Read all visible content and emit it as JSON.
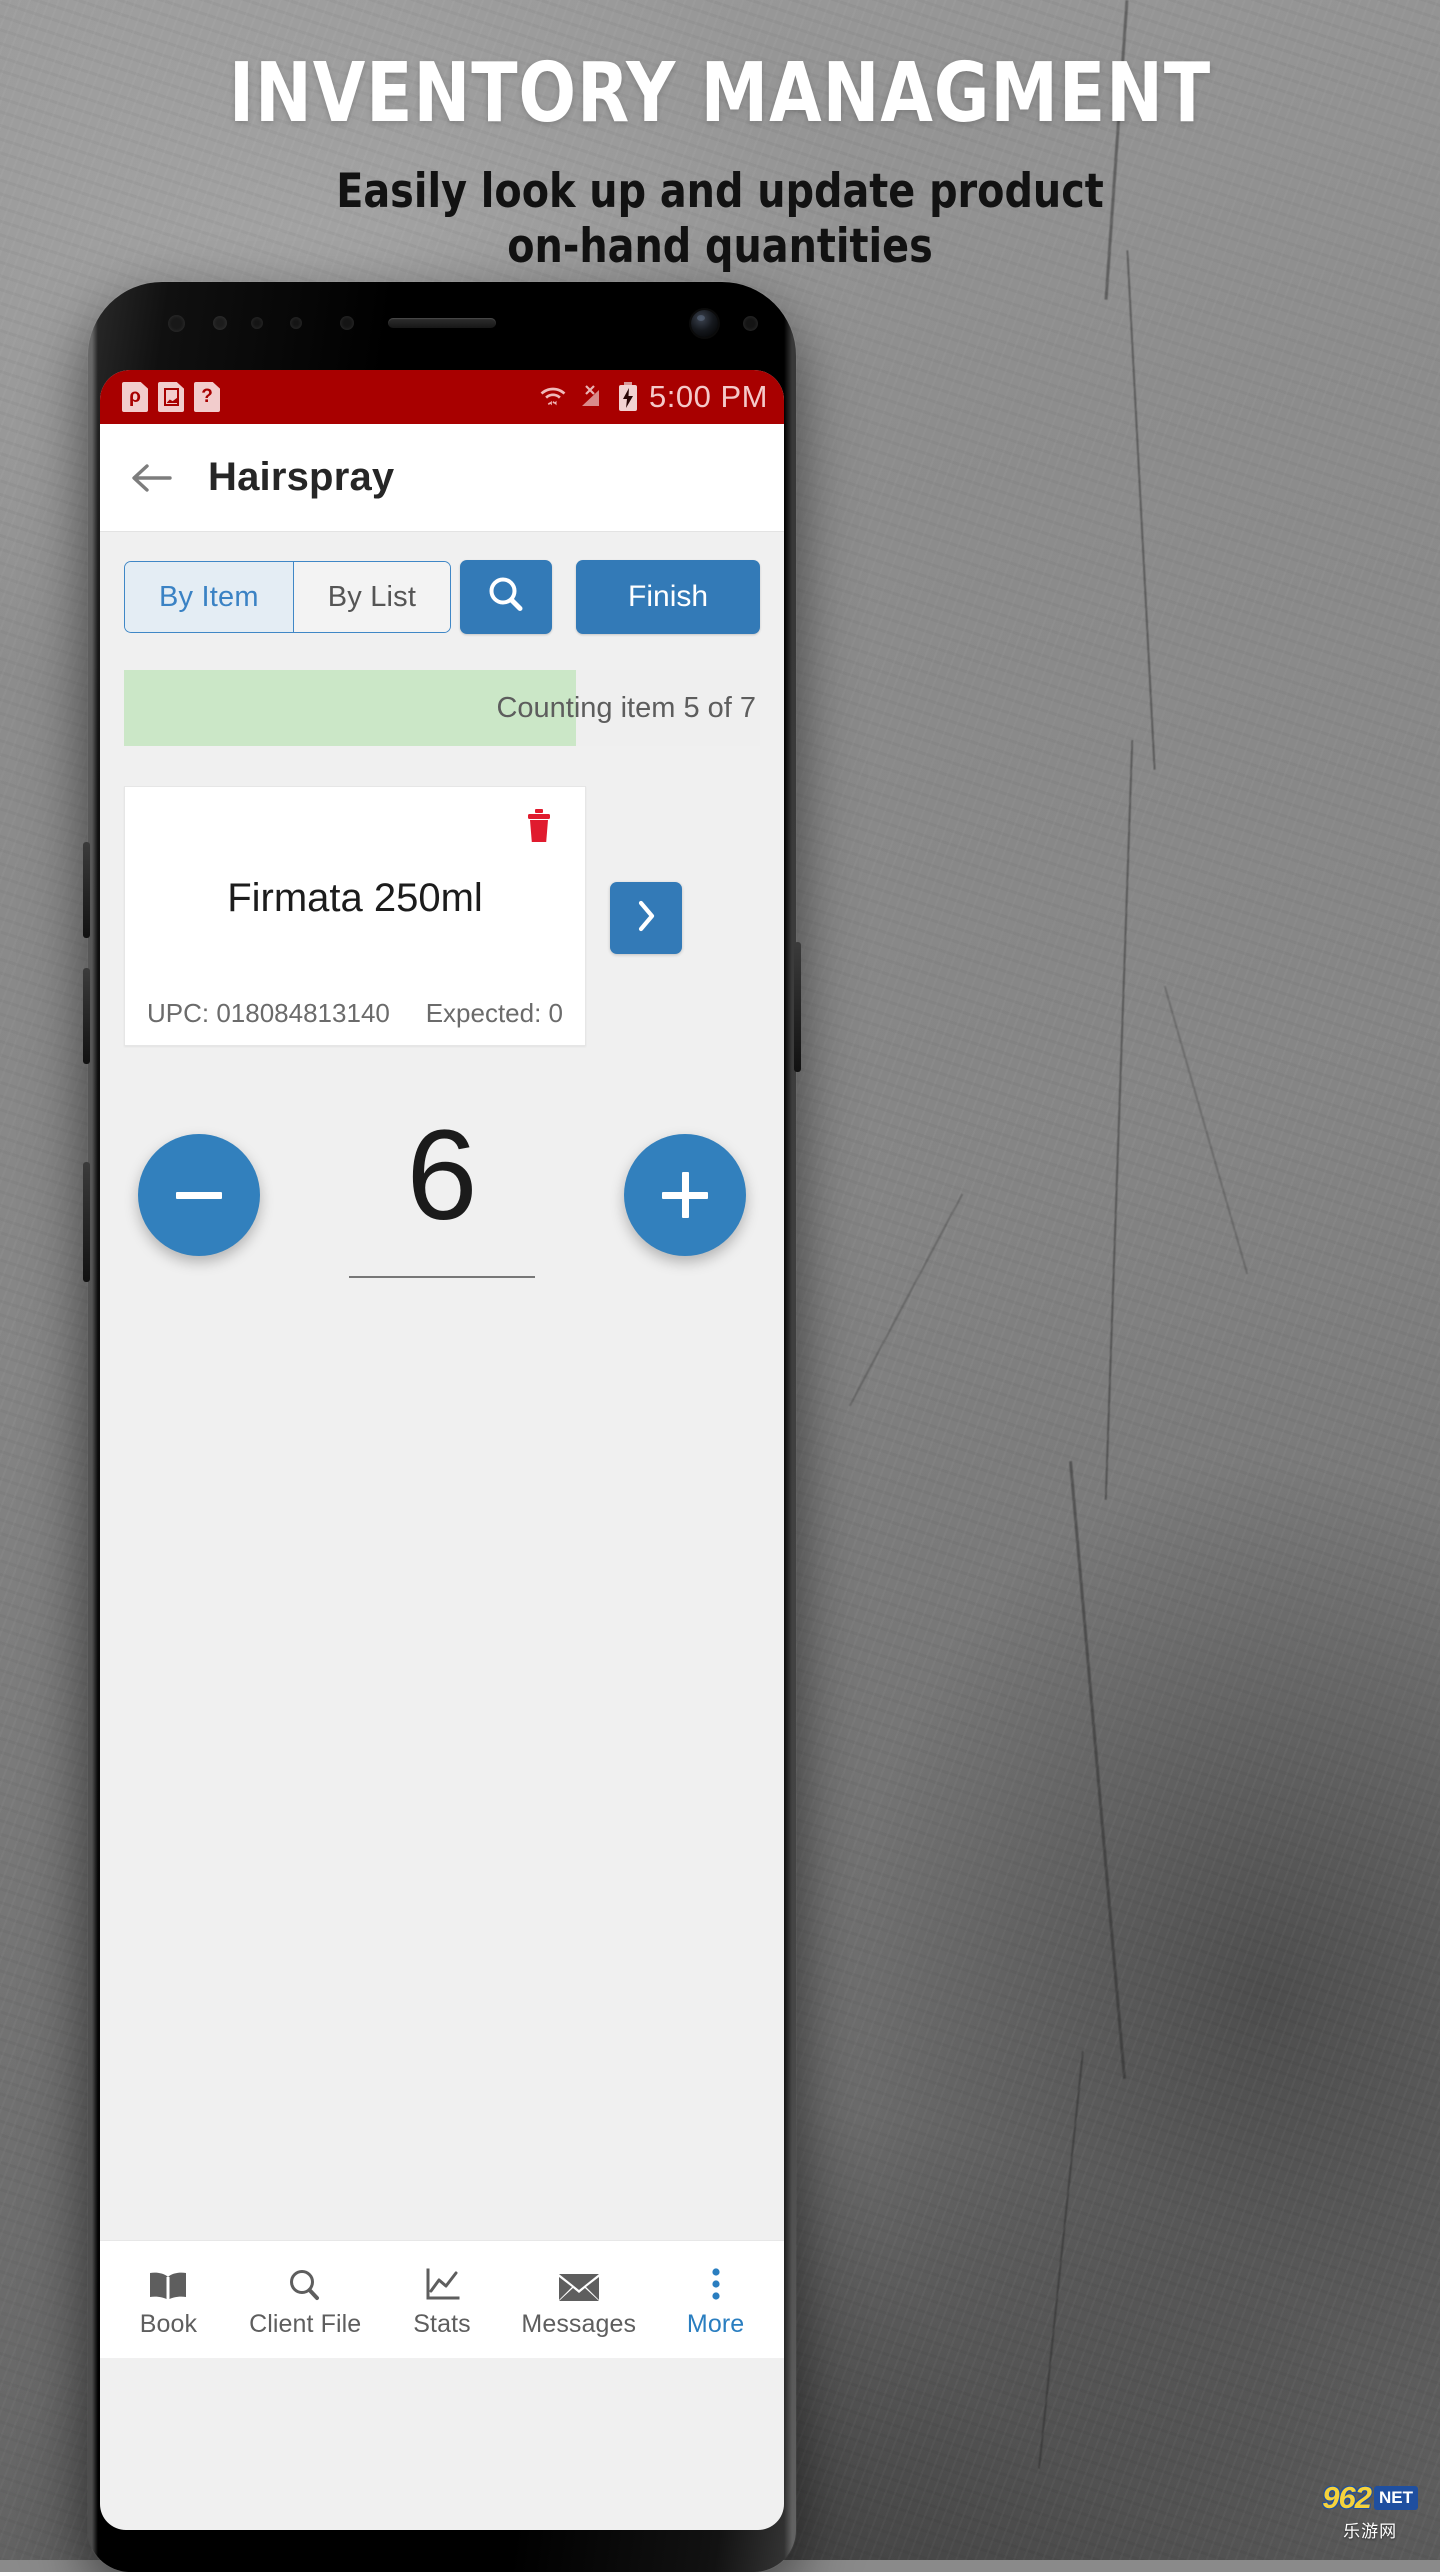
{
  "promo": {
    "headline": "INVENTORY MANAGMENT",
    "subhead_line1": "Easily look up and update product",
    "subhead_line2": "on-hand quantities"
  },
  "statusbar": {
    "notifications": [
      {
        "name": "app-badge-icon",
        "glyph": "ρ"
      },
      {
        "name": "image-icon",
        "glyph": ""
      },
      {
        "name": "help-icon",
        "glyph": "?"
      }
    ],
    "wifi_icon": "wifi-data-icon",
    "signal_icon": "no-signal-icon",
    "battery_icon": "battery-charging-icon",
    "clock": "5:00 PM",
    "background_color": "#a80000"
  },
  "appbar": {
    "back_icon": "back-arrow-icon",
    "title": "Hairspray"
  },
  "toolbar": {
    "segments": [
      {
        "label": "By Item",
        "selected": true
      },
      {
        "label": "By List",
        "selected": false
      }
    ],
    "search_icon": "search-icon",
    "finish_label": "Finish",
    "accent_color": "#337ab7"
  },
  "progress": {
    "label": "Counting item 5 of 7",
    "current": 5,
    "total": 7,
    "percent": 71,
    "fill_color": "#cbe7c7",
    "track_color": "#efefef"
  },
  "product_card": {
    "delete_icon": "trash-icon",
    "name": "Firmata 250ml",
    "upc_label": "UPC: 018084813140",
    "expected_label": "Expected: 0",
    "next_icon": "chevron-right-icon"
  },
  "stepper": {
    "decrement_icon": "minus-icon",
    "increment_icon": "plus-icon",
    "value": "6"
  },
  "bottom_nav": {
    "items": [
      {
        "label": "Book",
        "icon": "book-icon",
        "active": false
      },
      {
        "label": "Client File",
        "icon": "search-icon",
        "active": false
      },
      {
        "label": "Stats",
        "icon": "chart-line-icon",
        "active": false
      },
      {
        "label": "Messages",
        "icon": "envelope-icon",
        "active": false
      },
      {
        "label": "More",
        "icon": "more-vertical-icon",
        "active": true
      }
    ],
    "active_color": "#2a7ec0",
    "inactive_color": "#5e5e5e"
  },
  "watermark": {
    "number": "962",
    "net": "NET",
    "sub": "乐游网"
  }
}
